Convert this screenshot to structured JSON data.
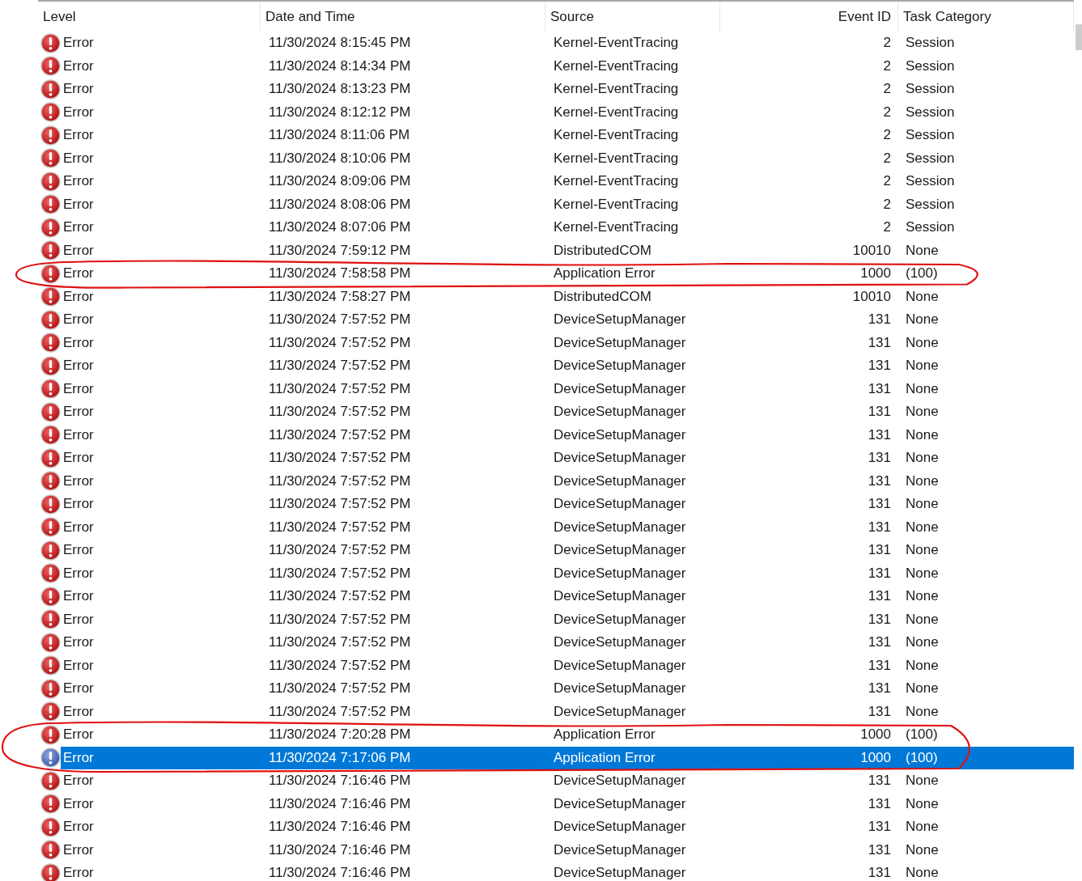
{
  "table": {
    "columns": [
      "Level",
      "Date and Time",
      "Source",
      "Event ID",
      "Task Category"
    ],
    "rows": [
      {
        "level": "Error",
        "date": "11/30/2024 8:15:45 PM",
        "source": "Kernel-EventTracing",
        "event_id": "2",
        "category": "Session",
        "selected": false,
        "circled": false
      },
      {
        "level": "Error",
        "date": "11/30/2024 8:14:34 PM",
        "source": "Kernel-EventTracing",
        "event_id": "2",
        "category": "Session",
        "selected": false,
        "circled": false
      },
      {
        "level": "Error",
        "date": "11/30/2024 8:13:23 PM",
        "source": "Kernel-EventTracing",
        "event_id": "2",
        "category": "Session",
        "selected": false,
        "circled": false
      },
      {
        "level": "Error",
        "date": "11/30/2024 8:12:12 PM",
        "source": "Kernel-EventTracing",
        "event_id": "2",
        "category": "Session",
        "selected": false,
        "circled": false
      },
      {
        "level": "Error",
        "date": "11/30/2024 8:11:06 PM",
        "source": "Kernel-EventTracing",
        "event_id": "2",
        "category": "Session",
        "selected": false,
        "circled": false
      },
      {
        "level": "Error",
        "date": "11/30/2024 8:10:06 PM",
        "source": "Kernel-EventTracing",
        "event_id": "2",
        "category": "Session",
        "selected": false,
        "circled": false
      },
      {
        "level": "Error",
        "date": "11/30/2024 8:09:06 PM",
        "source": "Kernel-EventTracing",
        "event_id": "2",
        "category": "Session",
        "selected": false,
        "circled": false
      },
      {
        "level": "Error",
        "date": "11/30/2024 8:08:06 PM",
        "source": "Kernel-EventTracing",
        "event_id": "2",
        "category": "Session",
        "selected": false,
        "circled": false
      },
      {
        "level": "Error",
        "date": "11/30/2024 8:07:06 PM",
        "source": "Kernel-EventTracing",
        "event_id": "2",
        "category": "Session",
        "selected": false,
        "circled": false
      },
      {
        "level": "Error",
        "date": "11/30/2024 7:59:12 PM",
        "source": "DistributedCOM",
        "event_id": "10010",
        "category": "None",
        "selected": false,
        "circled": false
      },
      {
        "level": "Error",
        "date": "11/30/2024 7:58:58 PM",
        "source": "Application Error",
        "event_id": "1000",
        "category": "(100)",
        "selected": false,
        "circled": true
      },
      {
        "level": "Error",
        "date": "11/30/2024 7:58:27 PM",
        "source": "DistributedCOM",
        "event_id": "10010",
        "category": "None",
        "selected": false,
        "circled": false
      },
      {
        "level": "Error",
        "date": "11/30/2024 7:57:52 PM",
        "source": "DeviceSetupManager",
        "event_id": "131",
        "category": "None",
        "selected": false,
        "circled": false
      },
      {
        "level": "Error",
        "date": "11/30/2024 7:57:52 PM",
        "source": "DeviceSetupManager",
        "event_id": "131",
        "category": "None",
        "selected": false,
        "circled": false
      },
      {
        "level": "Error",
        "date": "11/30/2024 7:57:52 PM",
        "source": "DeviceSetupManager",
        "event_id": "131",
        "category": "None",
        "selected": false,
        "circled": false
      },
      {
        "level": "Error",
        "date": "11/30/2024 7:57:52 PM",
        "source": "DeviceSetupManager",
        "event_id": "131",
        "category": "None",
        "selected": false,
        "circled": false
      },
      {
        "level": "Error",
        "date": "11/30/2024 7:57:52 PM",
        "source": "DeviceSetupManager",
        "event_id": "131",
        "category": "None",
        "selected": false,
        "circled": false
      },
      {
        "level": "Error",
        "date": "11/30/2024 7:57:52 PM",
        "source": "DeviceSetupManager",
        "event_id": "131",
        "category": "None",
        "selected": false,
        "circled": false
      },
      {
        "level": "Error",
        "date": "11/30/2024 7:57:52 PM",
        "source": "DeviceSetupManager",
        "event_id": "131",
        "category": "None",
        "selected": false,
        "circled": false
      },
      {
        "level": "Error",
        "date": "11/30/2024 7:57:52 PM",
        "source": "DeviceSetupManager",
        "event_id": "131",
        "category": "None",
        "selected": false,
        "circled": false
      },
      {
        "level": "Error",
        "date": "11/30/2024 7:57:52 PM",
        "source": "DeviceSetupManager",
        "event_id": "131",
        "category": "None",
        "selected": false,
        "circled": false
      },
      {
        "level": "Error",
        "date": "11/30/2024 7:57:52 PM",
        "source": "DeviceSetupManager",
        "event_id": "131",
        "category": "None",
        "selected": false,
        "circled": false
      },
      {
        "level": "Error",
        "date": "11/30/2024 7:57:52 PM",
        "source": "DeviceSetupManager",
        "event_id": "131",
        "category": "None",
        "selected": false,
        "circled": false
      },
      {
        "level": "Error",
        "date": "11/30/2024 7:57:52 PM",
        "source": "DeviceSetupManager",
        "event_id": "131",
        "category": "None",
        "selected": false,
        "circled": false
      },
      {
        "level": "Error",
        "date": "11/30/2024 7:57:52 PM",
        "source": "DeviceSetupManager",
        "event_id": "131",
        "category": "None",
        "selected": false,
        "circled": false
      },
      {
        "level": "Error",
        "date": "11/30/2024 7:57:52 PM",
        "source": "DeviceSetupManager",
        "event_id": "131",
        "category": "None",
        "selected": false,
        "circled": false
      },
      {
        "level": "Error",
        "date": "11/30/2024 7:57:52 PM",
        "source": "DeviceSetupManager",
        "event_id": "131",
        "category": "None",
        "selected": false,
        "circled": false
      },
      {
        "level": "Error",
        "date": "11/30/2024 7:57:52 PM",
        "source": "DeviceSetupManager",
        "event_id": "131",
        "category": "None",
        "selected": false,
        "circled": false
      },
      {
        "level": "Error",
        "date": "11/30/2024 7:57:52 PM",
        "source": "DeviceSetupManager",
        "event_id": "131",
        "category": "None",
        "selected": false,
        "circled": false
      },
      {
        "level": "Error",
        "date": "11/30/2024 7:57:52 PM",
        "source": "DeviceSetupManager",
        "event_id": "131",
        "category": "None",
        "selected": false,
        "circled": false
      },
      {
        "level": "Error",
        "date": "11/30/2024 7:20:28 PM",
        "source": "Application Error",
        "event_id": "1000",
        "category": "(100)",
        "selected": false,
        "circled": true
      },
      {
        "level": "Error",
        "date": "11/30/2024 7:17:06 PM",
        "source": "Application Error",
        "event_id": "1000",
        "category": "(100)",
        "selected": true,
        "circled": true
      },
      {
        "level": "Error",
        "date": "11/30/2024 7:16:46 PM",
        "source": "DeviceSetupManager",
        "event_id": "131",
        "category": "None",
        "selected": false,
        "circled": false
      },
      {
        "level": "Error",
        "date": "11/30/2024 7:16:46 PM",
        "source": "DeviceSetupManager",
        "event_id": "131",
        "category": "None",
        "selected": false,
        "circled": false
      },
      {
        "level": "Error",
        "date": "11/30/2024 7:16:46 PM",
        "source": "DeviceSetupManager",
        "event_id": "131",
        "category": "None",
        "selected": false,
        "circled": false
      },
      {
        "level": "Error",
        "date": "11/30/2024 7:16:46 PM",
        "source": "DeviceSetupManager",
        "event_id": "131",
        "category": "None",
        "selected": false,
        "circled": false
      },
      {
        "level": "Error",
        "date": "11/30/2024 7:16:46 PM",
        "source": "DeviceSetupManager",
        "event_id": "131",
        "category": "None",
        "selected": false,
        "circled": false
      }
    ]
  }
}
